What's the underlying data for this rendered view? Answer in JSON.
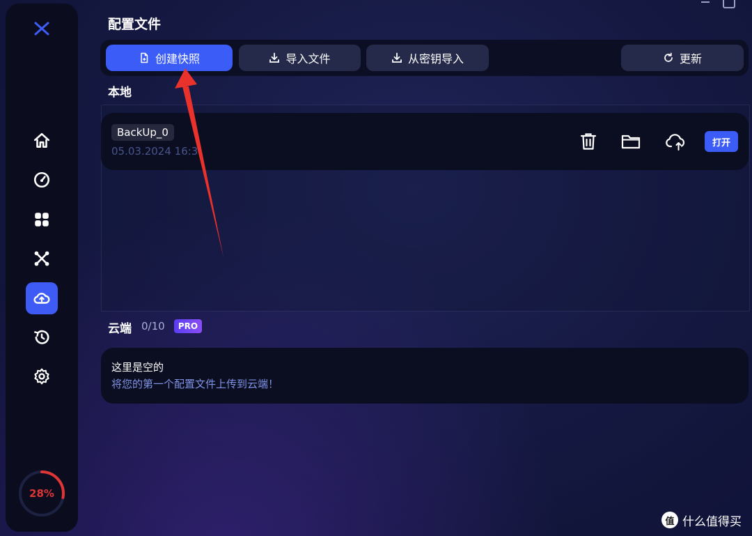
{
  "page_title": "配置文件",
  "toolbar": {
    "create_snapshot": "创建快照",
    "import_file": "导入文件",
    "import_from_key": "从密钥导入",
    "refresh": "更新"
  },
  "local": {
    "label": "本地",
    "backups": [
      {
        "name": "BackUp_0",
        "date": "05.03.2024 16:3",
        "open_label": "打开"
      }
    ]
  },
  "cloud": {
    "label": "云端",
    "count": "0/10",
    "badge": "PRO",
    "empty_title": "这里是空的",
    "empty_subtitle": "将您的第一个配置文件上传到云端！"
  },
  "sidebar": {
    "items": [
      {
        "name": "home-icon"
      },
      {
        "name": "speedometer-icon"
      },
      {
        "name": "apps-grid-icon"
      },
      {
        "name": "network-icon"
      },
      {
        "name": "cloud-upload-icon",
        "active": true
      },
      {
        "name": "history-icon"
      },
      {
        "name": "settings-icon"
      }
    ],
    "cpu_usage": "28%",
    "cpu_fraction": 0.28
  },
  "watermark": {
    "logo": "值",
    "text": "什么值得买"
  },
  "colors": {
    "accent": "#3b5cf7",
    "annotation": "#e8322b",
    "gauge": "#e03535"
  }
}
